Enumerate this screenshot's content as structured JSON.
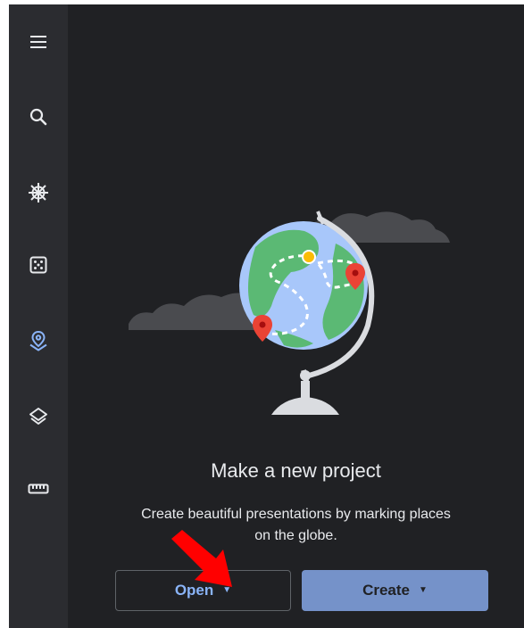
{
  "rail": {
    "items": [
      {
        "name": "menu-icon"
      },
      {
        "name": "search-icon"
      },
      {
        "name": "voyager-icon"
      },
      {
        "name": "dice-icon"
      },
      {
        "name": "projects-icon",
        "active": true
      },
      {
        "name": "layers-icon"
      },
      {
        "name": "measure-icon"
      }
    ]
  },
  "project": {
    "heading": "Make a new project",
    "description_line1": "Create beautiful presentations by marking places",
    "description_line2": "on the globe."
  },
  "buttons": {
    "open_label": "Open",
    "create_label": "Create"
  },
  "colors": {
    "background": "#202124",
    "rail": "#2b2c30",
    "accent": "#8ab4f8",
    "create_fill": "#7592c9",
    "annotation_arrow": "#ff0000"
  }
}
